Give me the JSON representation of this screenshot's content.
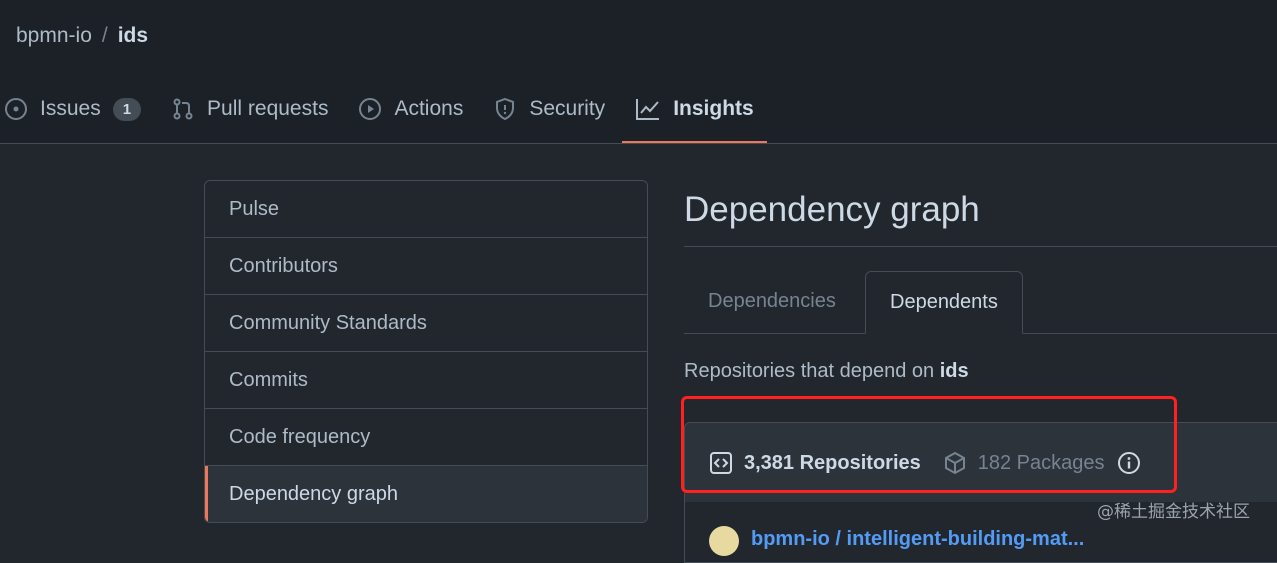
{
  "breadcrumb": {
    "owner": "bpmn-io",
    "separator": "/",
    "repo": "ids"
  },
  "nav": {
    "issues": {
      "label": "Issues",
      "count": "1"
    },
    "pulls": {
      "label": "Pull requests"
    },
    "actions": {
      "label": "Actions"
    },
    "security": {
      "label": "Security"
    },
    "insights": {
      "label": "Insights"
    }
  },
  "sidebar": {
    "items": [
      {
        "label": "Pulse"
      },
      {
        "label": "Contributors"
      },
      {
        "label": "Community Standards"
      },
      {
        "label": "Commits"
      },
      {
        "label": "Code frequency"
      },
      {
        "label": "Dependency graph",
        "selected": true
      }
    ]
  },
  "main": {
    "title": "Dependency graph",
    "tabs": [
      {
        "label": "Dependencies"
      },
      {
        "label": "Dependents",
        "active": true
      }
    ],
    "description": {
      "text": "Repositories that depend on ",
      "repo": "ids"
    },
    "summary": {
      "repositories": "3,381 Repositories",
      "packages": "182 Packages"
    },
    "first_dependent": "bpmn-io / intelligent-building-mat..."
  },
  "colors": {
    "accent": "#ec775c",
    "highlight": "#ff2020",
    "link": "#539bf5"
  },
  "watermark": "@稀土掘金技术社区"
}
